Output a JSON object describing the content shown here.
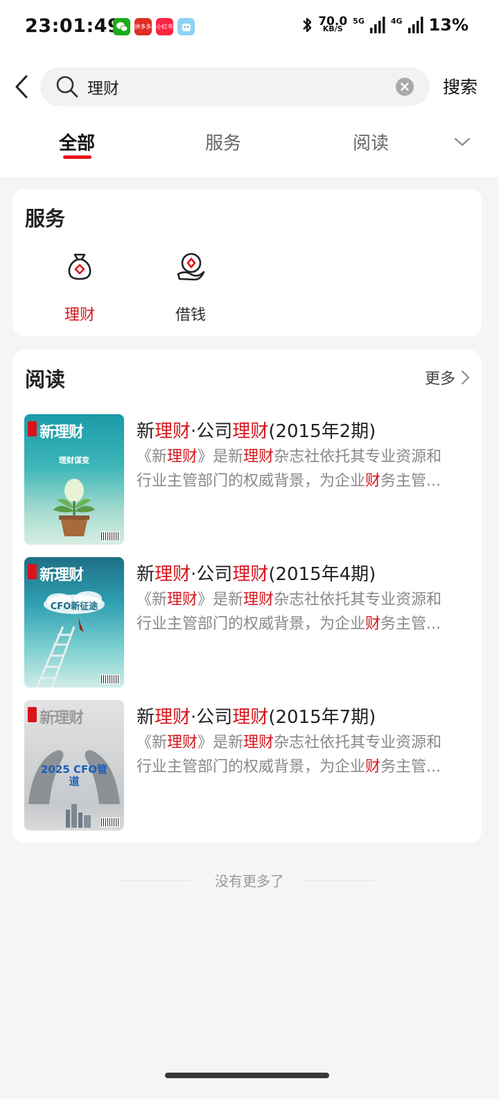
{
  "status_bar": {
    "time": "23:01:49",
    "app_icons": [
      {
        "name": "wechat-icon",
        "color": "#1aad19",
        "label": ""
      },
      {
        "name": "pinduoduo-icon",
        "color": "#e02e24",
        "label": "拼多多"
      },
      {
        "name": "xiaohongshu-icon",
        "color": "#ff2442",
        "label": "小红书"
      },
      {
        "name": "app-icon-blue",
        "color": "#8fd3f4",
        "label": ""
      }
    ],
    "net_speed": "70.0",
    "net_speed_unit": "KB/S",
    "net_5g": "5G",
    "net_4g": "4G",
    "battery": "13%"
  },
  "search": {
    "query": "理财",
    "button_label": "搜索"
  },
  "tabs": [
    {
      "label": "全部",
      "active": true
    },
    {
      "label": "服务",
      "active": false
    },
    {
      "label": "阅读",
      "active": false
    }
  ],
  "services": {
    "title": "服务",
    "items": [
      {
        "label": "理财",
        "icon": "money-bag-icon",
        "active": true
      },
      {
        "label": "借钱",
        "icon": "hand-coin-icon",
        "active": false
      }
    ]
  },
  "reading": {
    "title": "阅读",
    "more_label": "更多",
    "articles": [
      {
        "title_parts": [
          "新",
          "理财",
          "·公司",
          "理财",
          "(2015年2期)"
        ],
        "desc_line1_parts": [
          "《新",
          "理财",
          "》是新",
          "理财",
          "杂志社依托其专业资源和"
        ],
        "desc_line2_parts": [
          "行业主管部门的权威背景，为企业",
          "财",
          "务主管..."
        ],
        "cover_name": "新理财",
        "cover_text": "理财谋变"
      },
      {
        "title_parts": [
          "新",
          "理财",
          "·公司",
          "理财",
          "(2015年4期)"
        ],
        "desc_line1_parts": [
          "《新",
          "理财",
          "》是新",
          "理财",
          "杂志社依托其专业资源和"
        ],
        "desc_line2_parts": [
          "行业主管部门的权威背景，为企业",
          "财",
          "务主管..."
        ],
        "cover_name": "新理财",
        "cover_text": "CFO新征途"
      },
      {
        "title_parts": [
          "新",
          "理财",
          "·公司",
          "理财",
          "(2015年7期)"
        ],
        "desc_line1_parts": [
          "《新",
          "理财",
          "》是新",
          "理财",
          "杂志社依托其专业资源和"
        ],
        "desc_line2_parts": [
          "行业主管部门的权威背景，为企业",
          "财",
          "务主管..."
        ],
        "cover_name": "新理财",
        "cover_text": "2025 CFO管道"
      }
    ]
  },
  "footer": {
    "no_more_text": "没有更多了"
  },
  "colors": {
    "accent": "#e4141d",
    "highlight": "#d6161c",
    "background": "#f5f5f5"
  }
}
